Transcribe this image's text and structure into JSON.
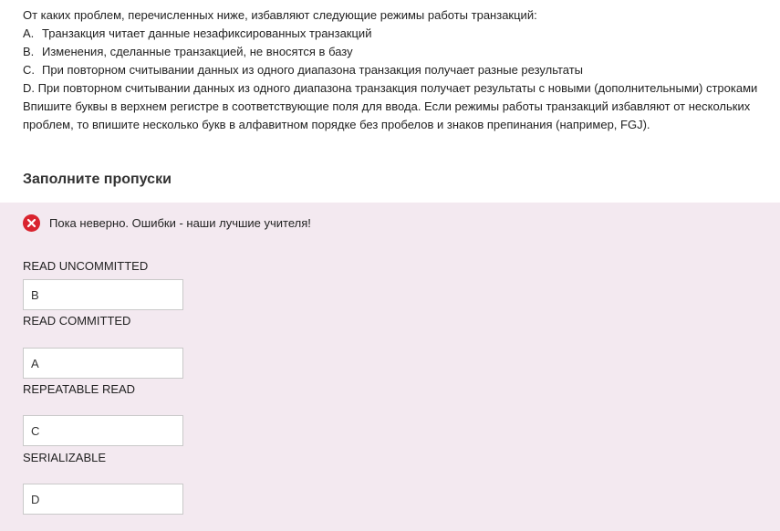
{
  "question": {
    "intro": "От каких проблем, перечисленных ниже, избавляют следующие режимы работы транзакций:",
    "options": [
      {
        "letter": "A.",
        "text": "Транзакция читает данные незафиксированных транзакций"
      },
      {
        "letter": "B.",
        "text": "Изменения, сделанные транзакцией, не вносятся в базу"
      },
      {
        "letter": "C.",
        "text": "При повторном считывании данных из одного диапазона транзакция получает разные результаты"
      }
    ],
    "option_d": "D. При повторном считывании данных из одного диапазона транзакция получает результаты с новыми (дополнительными) строками",
    "instructions": "Впишите буквы в верхнем регистре в соответствующие поля для ввода. Если режимы работы транзакций избавляют от нескольких проблем, то впишите несколько букв в алфавитном порядке без пробелов и знаков препинания (например, FGJ)."
  },
  "section_title": "Заполните пропуски",
  "feedback": {
    "icon": "error-circle-icon",
    "text": "Пока неверно. Ошибки - наши лучшие учителя!",
    "color": "#d9232e"
  },
  "fields": [
    {
      "label": "READ UNCOMMITTED",
      "value": "B"
    },
    {
      "label": "READ COMMITTED",
      "value": "A"
    },
    {
      "label": "REPEATABLE READ",
      "value": "C"
    },
    {
      "label": "SERIALIZABLE",
      "value": "D"
    }
  ],
  "colors": {
    "feedback_background": "#f3e9f0",
    "input_border": "#c9c9c9"
  }
}
